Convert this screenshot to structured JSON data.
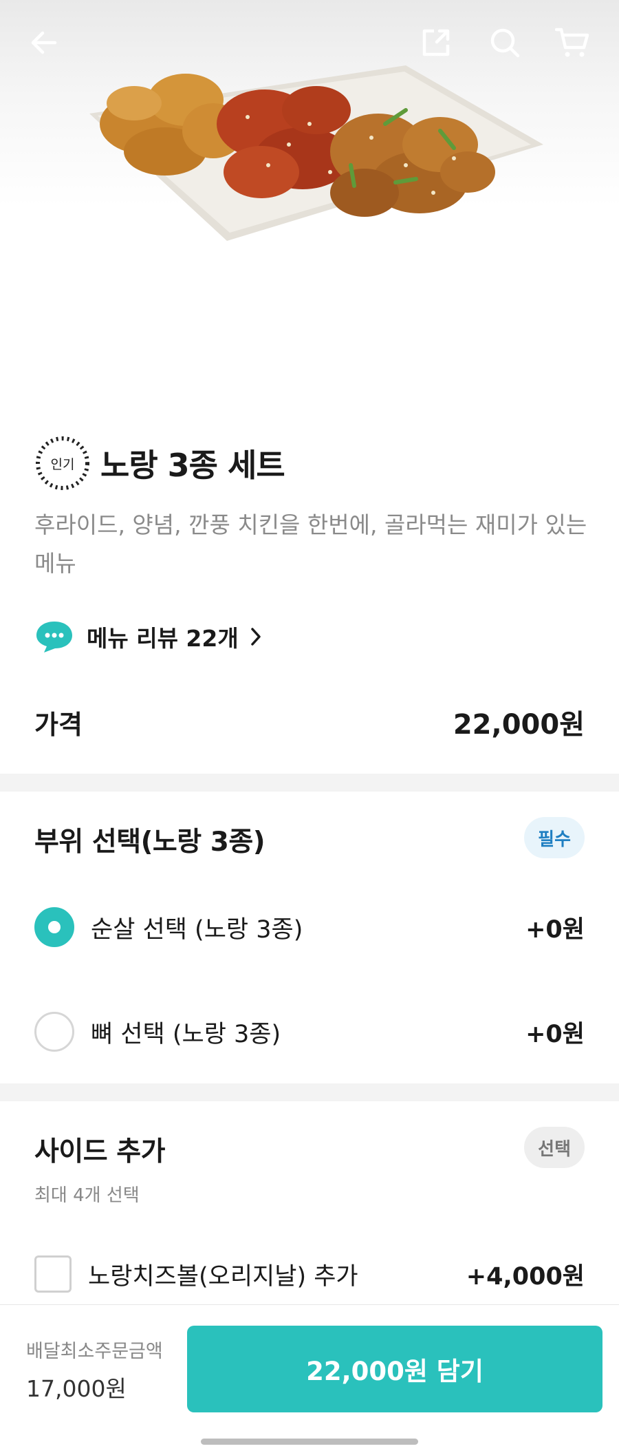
{
  "header": {
    "back_icon": "arrow-left-icon",
    "share_icon": "share-icon",
    "search_icon": "search-icon",
    "cart_icon": "cart-icon"
  },
  "menu": {
    "badge": "인기",
    "title": "노랑 3종 세트",
    "description": "후라이드, 양념, 깐풍 치킨을 한번에, 골라먹는 재미가 있는 메뉴",
    "review_label": "메뉴 리뷰 22개",
    "price_label": "가격",
    "price": "22,000원"
  },
  "part_section": {
    "title": "부위 선택(노랑 3종)",
    "badge": "필수",
    "options": [
      {
        "label": "순살 선택 (노랑 3종)",
        "price": "+0원",
        "selected": true
      },
      {
        "label": "뼈 선택 (노랑 3종)",
        "price": "+0원",
        "selected": false
      }
    ]
  },
  "side_section": {
    "title": "사이드 추가",
    "badge": "선택",
    "subtitle": "최대 4개 선택",
    "options": [
      {
        "label": "노랑치즈볼(오리지날) 추가",
        "price": "+4,000원",
        "checked": false
      }
    ]
  },
  "footer": {
    "min_order_label": "배달최소주문금액",
    "min_order_value": "17,000원",
    "cta_label": "22,000원 담기"
  },
  "colors": {
    "accent": "#2ac1bc",
    "required_badge_text": "#1f7fc2",
    "required_badge_bg": "#e8f4fb"
  }
}
